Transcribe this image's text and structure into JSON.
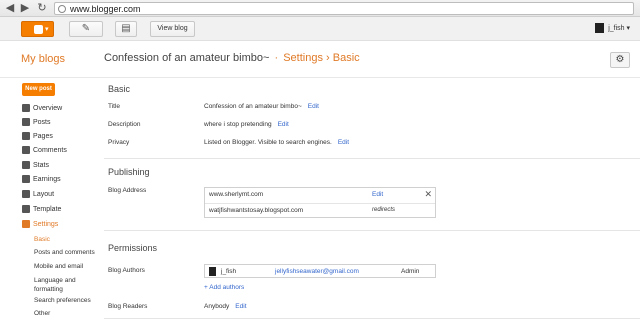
{
  "browser": {
    "url": "www.blogger.com"
  },
  "topbar": {
    "view_blog_label": "View blog",
    "user_name": "j_fish",
    "dropdown_glyph": "▾"
  },
  "header": {
    "my_blogs": "My blogs",
    "blog_title": "Confession of an amateur bimbo~",
    "sep1": "·",
    "settings": "Settings",
    "sep2": "›",
    "page": "Basic"
  },
  "sidebar": {
    "new_post": "New post",
    "items": [
      {
        "label": "Overview",
        "icon": "home-icon"
      },
      {
        "label": "Posts",
        "icon": "posts-icon"
      },
      {
        "label": "Pages",
        "icon": "pages-icon"
      },
      {
        "label": "Comments",
        "icon": "comments-icon"
      },
      {
        "label": "Stats",
        "icon": "stats-icon"
      },
      {
        "label": "Earnings",
        "icon": "earnings-icon"
      },
      {
        "label": "Layout",
        "icon": "layout-icon"
      },
      {
        "label": "Template",
        "icon": "template-icon"
      },
      {
        "label": "Settings",
        "icon": "wrench-icon"
      }
    ],
    "sub_items": [
      "Basic",
      "Posts and comments",
      "Mobile and email",
      "Language and",
      "formatting",
      "Search preferences",
      "Other"
    ]
  },
  "basic": {
    "section_title": "Basic",
    "title_label": "Title",
    "title_value": "Confession of an amateur bimbo~",
    "description_label": "Description",
    "description_value": "where i stop pretending",
    "privacy_label": "Privacy",
    "privacy_value": "Listed on Blogger. Visible to search engines.",
    "edit": "Edit"
  },
  "publishing": {
    "section_title": "Publishing",
    "blog_address_label": "Blog Address",
    "custom_domain": "www.sherlymt.com",
    "edit": "Edit",
    "blogspot_address": "watjfishwantstosay.blogspot.com",
    "redirects": "redirects",
    "close_glyph": "✕"
  },
  "permissions": {
    "section_title": "Permissions",
    "authors_label": "Blog Authors",
    "author_name": "j_fish",
    "author_email": "jellyfishseawater@gmail.com",
    "author_role": "Admin",
    "add_authors": "+ Add authors",
    "readers_label": "Blog Readers",
    "readers_value": "Anybody",
    "edit": "Edit"
  },
  "colors": {
    "accent": "#f57d00",
    "link": "#3366cc"
  }
}
